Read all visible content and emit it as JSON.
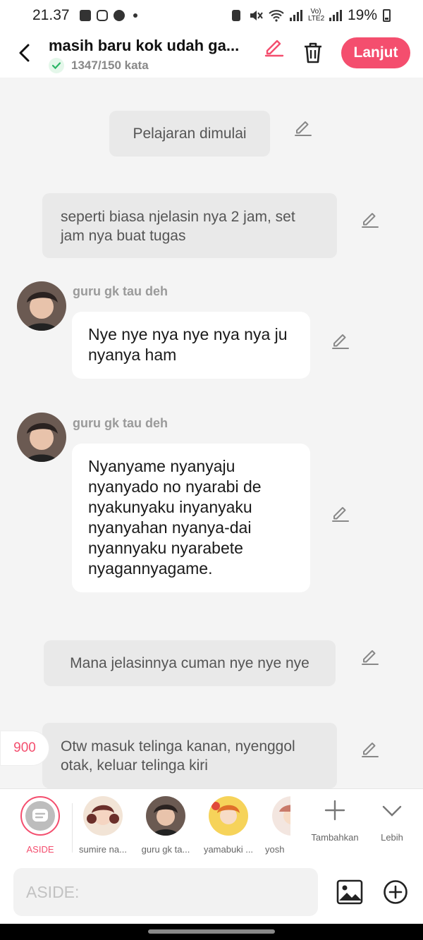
{
  "status_bar": {
    "time": "21.37",
    "signal_label": "Vo) LTE2",
    "battery": "19%"
  },
  "header": {
    "title": "masih baru kok udah ga...",
    "word_count": "1347/150 kata",
    "next_label": "Lanjut"
  },
  "chat": {
    "messages": [
      {
        "type": "narration",
        "text": "Pelajaran dimulai"
      },
      {
        "type": "narration",
        "text": "seperti biasa njelasin nya 2 jam, set jam nya buat tugas"
      },
      {
        "type": "character",
        "name": "guru gk tau deh",
        "text": "Nye nye nya nye nya nya ju nyanya ham"
      },
      {
        "type": "character",
        "name": "guru gk tau deh",
        "text": "Nyanyame nyanyaju nyanyado no nyarabi de nyakunyaku inyanyaku nyanyahan nyanya-dai nyannyaku nyarabete nyagannyagame."
      },
      {
        "type": "narration",
        "text": "Mana jelasinnya cuman nye nye nye"
      },
      {
        "type": "narration",
        "text": "Otw masuk telinga kanan, nyenggol otak, keluar telinga kiri"
      }
    ],
    "counter_badge": "900"
  },
  "character_bar": {
    "items": [
      {
        "label": "ASIDE"
      },
      {
        "label": "sumire na..."
      },
      {
        "label": "guru gk ta..."
      },
      {
        "label": "yamabuki ..."
      },
      {
        "label": "yosh"
      }
    ],
    "add_label": "Tambahkan",
    "more_label": "Lebih"
  },
  "input": {
    "placeholder": "ASIDE:"
  },
  "colors": {
    "accent": "#f44e6e",
    "background": "#f4f4f4",
    "narration_bg": "#e9e9e9"
  }
}
